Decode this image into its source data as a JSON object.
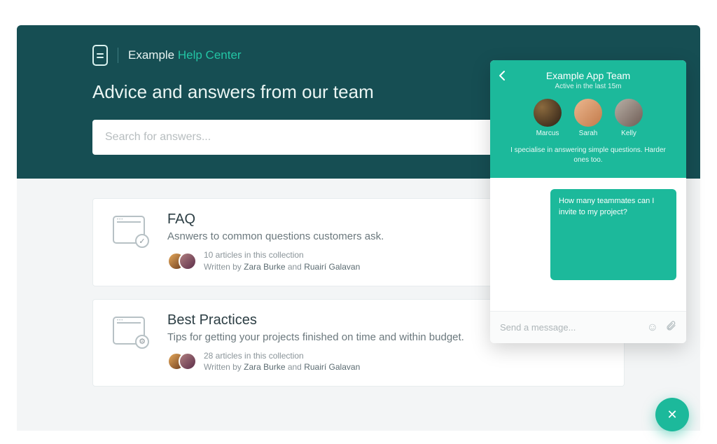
{
  "brand": {
    "name": "Example",
    "suffix": "Help Center"
  },
  "hero": {
    "tagline": "Advice and answers from our team",
    "search_placeholder": "Search for answers..."
  },
  "collections": [
    {
      "icon": "faq",
      "title": "FAQ",
      "description": "Asnwers to common questions customers ask.",
      "article_count": "10 articles in this collection",
      "written_prefix": "Written by ",
      "author1": "Zara Burke",
      "and": " and ",
      "author2": "Ruairí Galavan"
    },
    {
      "icon": "settings",
      "title": "Best Practices",
      "description": "Tips for getting your projects finished on time and within budget.",
      "article_count": "28 articles in this collection",
      "written_prefix": "Written by ",
      "author1": "Zara Burke",
      "and": " and ",
      "author2": "Ruairí Galavan"
    }
  ],
  "chat": {
    "title": "Example App Team",
    "subtitle": "Active in the last 15m",
    "people": [
      {
        "name": "Marcus"
      },
      {
        "name": "Sarah"
      },
      {
        "name": "Kelly"
      }
    ],
    "blurb": "I specialise in answering simple questions. Harder ones too.",
    "message": "How many teammates can I invite to my project?",
    "input_placeholder": "Send a message..."
  }
}
